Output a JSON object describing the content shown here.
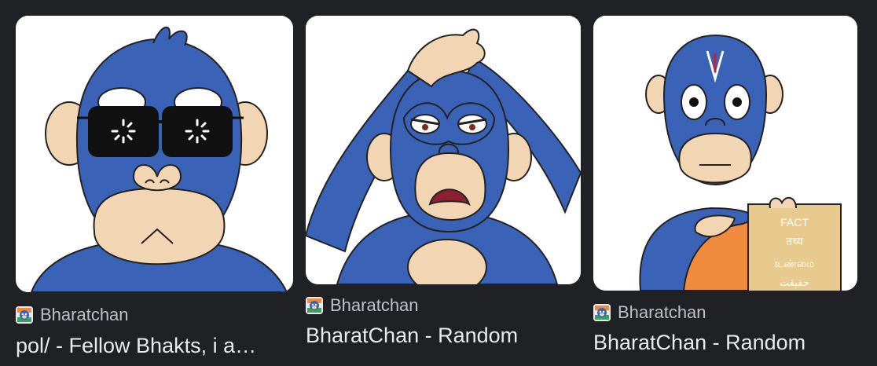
{
  "results": [
    {
      "source": "Bharatchan",
      "title": "pol/ - Fellow Bhakts, i a…",
      "image_icon": "blue-monkey-sunglasses-image"
    },
    {
      "source": "Bharatchan",
      "title": "BharatChan - Random",
      "image_icon": "blue-monkey-facepalm-image"
    },
    {
      "source": "Bharatchan",
      "title": "BharatChan - Random",
      "image_icon": "blue-monkey-fact-sign-image",
      "sign_lines": [
        "FACT",
        "तथ्य",
        "உண்மை",
        "حقیقت"
      ]
    }
  ],
  "colors": {
    "background": "#202124",
    "monkey_blue": "#3a63b8",
    "skin": "#f2d6b3",
    "robe": "#f08a3c",
    "sign": "#e8c98e"
  }
}
